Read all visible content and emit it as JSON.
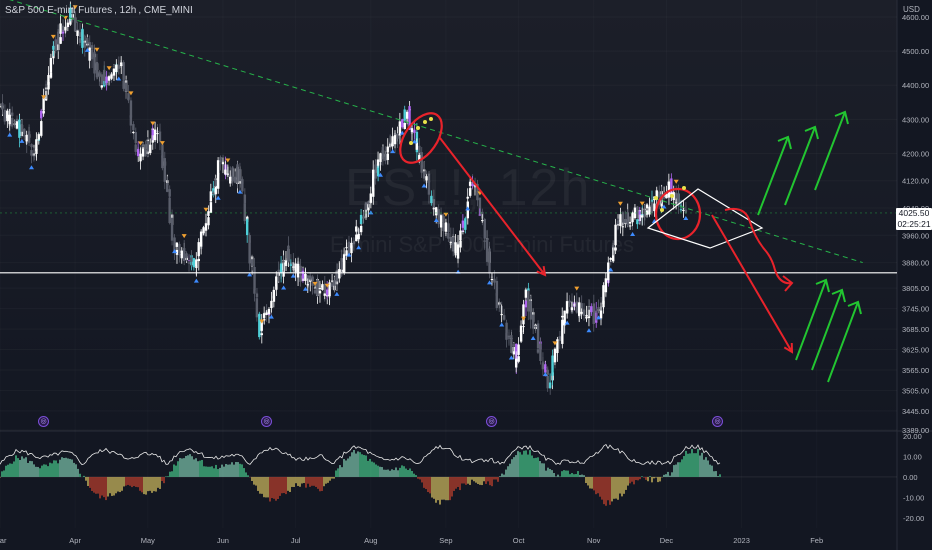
{
  "header": {
    "symbol": "S&P 500 E-mini Futures",
    "interval": "12h",
    "exchange": "CME_MINI",
    "watermark_ticker": "ES1!, 12h",
    "watermark_name": "E-mini S&P 500 E-mini Futures"
  },
  "price_axis": {
    "currency": "USD",
    "last_price": "4025.50",
    "countdown": "02:25:21"
  },
  "colors": {
    "background": "#131722",
    "candle_up": "#ffffff",
    "candle_accent_purple": "#b066f2",
    "candle_accent_cyan": "#4fd0d8",
    "trendline": "#26b34a",
    "support": "#ffffff",
    "annotation_red": "#e8232b",
    "annotation_green": "#22c531",
    "osc_green": "#4fe29a",
    "osc_red": "#d9462f",
    "osc_yellow": "#f2d86a"
  },
  "event_icons": [
    "event-icon",
    "event-icon",
    "event-icon",
    "event-icon"
  ],
  "chart_data": [
    {
      "type": "candlestick",
      "y_ticks": [
        4600,
        4500,
        4400,
        4300,
        4200,
        4120,
        4040,
        3960,
        3880,
        3805,
        3745,
        3685,
        3625,
        3565,
        3505,
        3445,
        3389
      ],
      "y_range": [
        3389,
        4650
      ],
      "x_ticks": [
        "Mar",
        "Apr",
        "May",
        "Jun",
        "Jul",
        "Aug",
        "Sep",
        "Oct",
        "Nov",
        "Dec",
        "2023",
        "Feb"
      ],
      "close_path": [
        {
          "date": "2022-03-01",
          "close": 4330
        },
        {
          "date": "2022-03-10",
          "close": 4260
        },
        {
          "date": "2022-03-15",
          "close": 4200
        },
        {
          "date": "2022-03-22",
          "close": 4480
        },
        {
          "date": "2022-03-29",
          "close": 4610
        },
        {
          "date": "2022-04-05",
          "close": 4520
        },
        {
          "date": "2022-04-12",
          "close": 4410
        },
        {
          "date": "2022-04-20",
          "close": 4450
        },
        {
          "date": "2022-04-27",
          "close": 4180
        },
        {
          "date": "2022-05-05",
          "close": 4280
        },
        {
          "date": "2022-05-12",
          "close": 3920
        },
        {
          "date": "2022-05-20",
          "close": 3870
        },
        {
          "date": "2022-05-30",
          "close": 4160
        },
        {
          "date": "2022-06-08",
          "close": 4130
        },
        {
          "date": "2022-06-16",
          "close": 3680
        },
        {
          "date": "2022-06-27",
          "close": 3910
        },
        {
          "date": "2022-07-05",
          "close": 3830
        },
        {
          "date": "2022-07-14",
          "close": 3790
        },
        {
          "date": "2022-07-26",
          "close": 3960
        },
        {
          "date": "2022-08-03",
          "close": 4150
        },
        {
          "date": "2022-08-16",
          "close": 4320
        },
        {
          "date": "2022-08-26",
          "close": 4060
        },
        {
          "date": "2022-09-06",
          "close": 3910
        },
        {
          "date": "2022-09-12",
          "close": 4130
        },
        {
          "date": "2022-09-22",
          "close": 3760
        },
        {
          "date": "2022-09-30",
          "close": 3590
        },
        {
          "date": "2022-10-04",
          "close": 3790
        },
        {
          "date": "2022-10-13",
          "close": 3520
        },
        {
          "date": "2022-10-21",
          "close": 3760
        },
        {
          "date": "2022-11-03",
          "close": 3720
        },
        {
          "date": "2022-11-11",
          "close": 4000
        },
        {
          "date": "2022-11-23",
          "close": 4030
        },
        {
          "date": "2022-12-01",
          "close": 4100
        },
        {
          "date": "2022-12-09",
          "close": 4025
        }
      ],
      "trendline": [
        {
          "date": "2022-03-01",
          "price": 4660
        },
        {
          "date": "2023-02-20",
          "price": 3880
        }
      ],
      "support_level": 3850,
      "last_price": 4025.5,
      "projection_down": [
        {
          "date": "2022-12-09",
          "price": 4025
        },
        {
          "date": "2023-01-15",
          "price": 3650
        }
      ],
      "projection_zigzag": [
        {
          "date": "2022-12-09",
          "price": 4030
        },
        {
          "date": "2023-01-05",
          "price": 3800
        }
      ]
    },
    {
      "type": "area",
      "name": "oscillator",
      "y_ticks": [
        20,
        10,
        0,
        -10,
        -20
      ],
      "y_range": [
        -25,
        22
      ]
    }
  ]
}
